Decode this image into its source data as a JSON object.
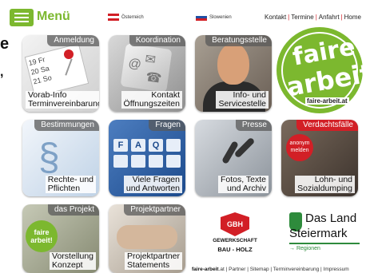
{
  "header": {
    "menu_label": "Menü",
    "lang_at": "Österreich",
    "lang_si": "Slowenien",
    "nav": [
      "Kontakt",
      "Termine",
      "Anfahrt",
      "Home"
    ]
  },
  "edge": {
    "line1": "e",
    "line2": ","
  },
  "tiles": {
    "anmeldung": {
      "head": "Anmeldung",
      "cap1": "Vorab-Info",
      "cap2": "Terminvereinbarung",
      "cal1": "19 Fr",
      "cal2": "20 Sa",
      "cal3": "21 So"
    },
    "koordination": {
      "head": "Koordination",
      "cap1": "Kontakt",
      "cap2": "Öffnungszeiten"
    },
    "beratung": {
      "head": "Beratungsstelle",
      "cap1": "Info- und",
      "cap2": "Servicestelle"
    },
    "logo": {
      "w1": "faire",
      "w2": "arbeit!",
      "url": "faire-arbeit.at"
    },
    "bestimmungen": {
      "head": "Bestimmungen",
      "cap1": "Rechte- und",
      "cap2": "Pflichten"
    },
    "fragen": {
      "head": "Fragen",
      "cap1": "Viele Fragen",
      "cap2": "und Antworten",
      "keys": [
        "F",
        "A",
        "Q"
      ]
    },
    "presse": {
      "head": "Presse",
      "cap1": "Fotos, Texte",
      "cap2": "und Archiv"
    },
    "verdacht": {
      "head": "Verdachtsfälle",
      "badge1": "anonym",
      "badge2": "melden",
      "cap1": "Lohn- und",
      "cap2": "Sozialdumping"
    },
    "projekt": {
      "head": "das Projekt",
      "badge1": "faire",
      "badge2": "arbeit!",
      "cap1": "Vorstellung",
      "cap2": "Konzept"
    },
    "partner": {
      "head": "Projektpartner",
      "cap1": "Projektpartner",
      "cap2": "Statements"
    }
  },
  "partners": {
    "ggb": {
      "shield": "GBH",
      "t1": "GEWERKSCHAFT",
      "t2": "BAU - HOLZ"
    },
    "stmk": {
      "l1": "Das Land",
      "l2": "Steiermark",
      "l3": "→ Regionen"
    }
  },
  "footer": {
    "brand": "faire-arbeit",
    "rest": ".at | Partner | Sitemap | Terminvereinbarung | Impressum"
  },
  "colors": {
    "brand_green": "#7cb82f",
    "accent_red": "#d21f26"
  }
}
